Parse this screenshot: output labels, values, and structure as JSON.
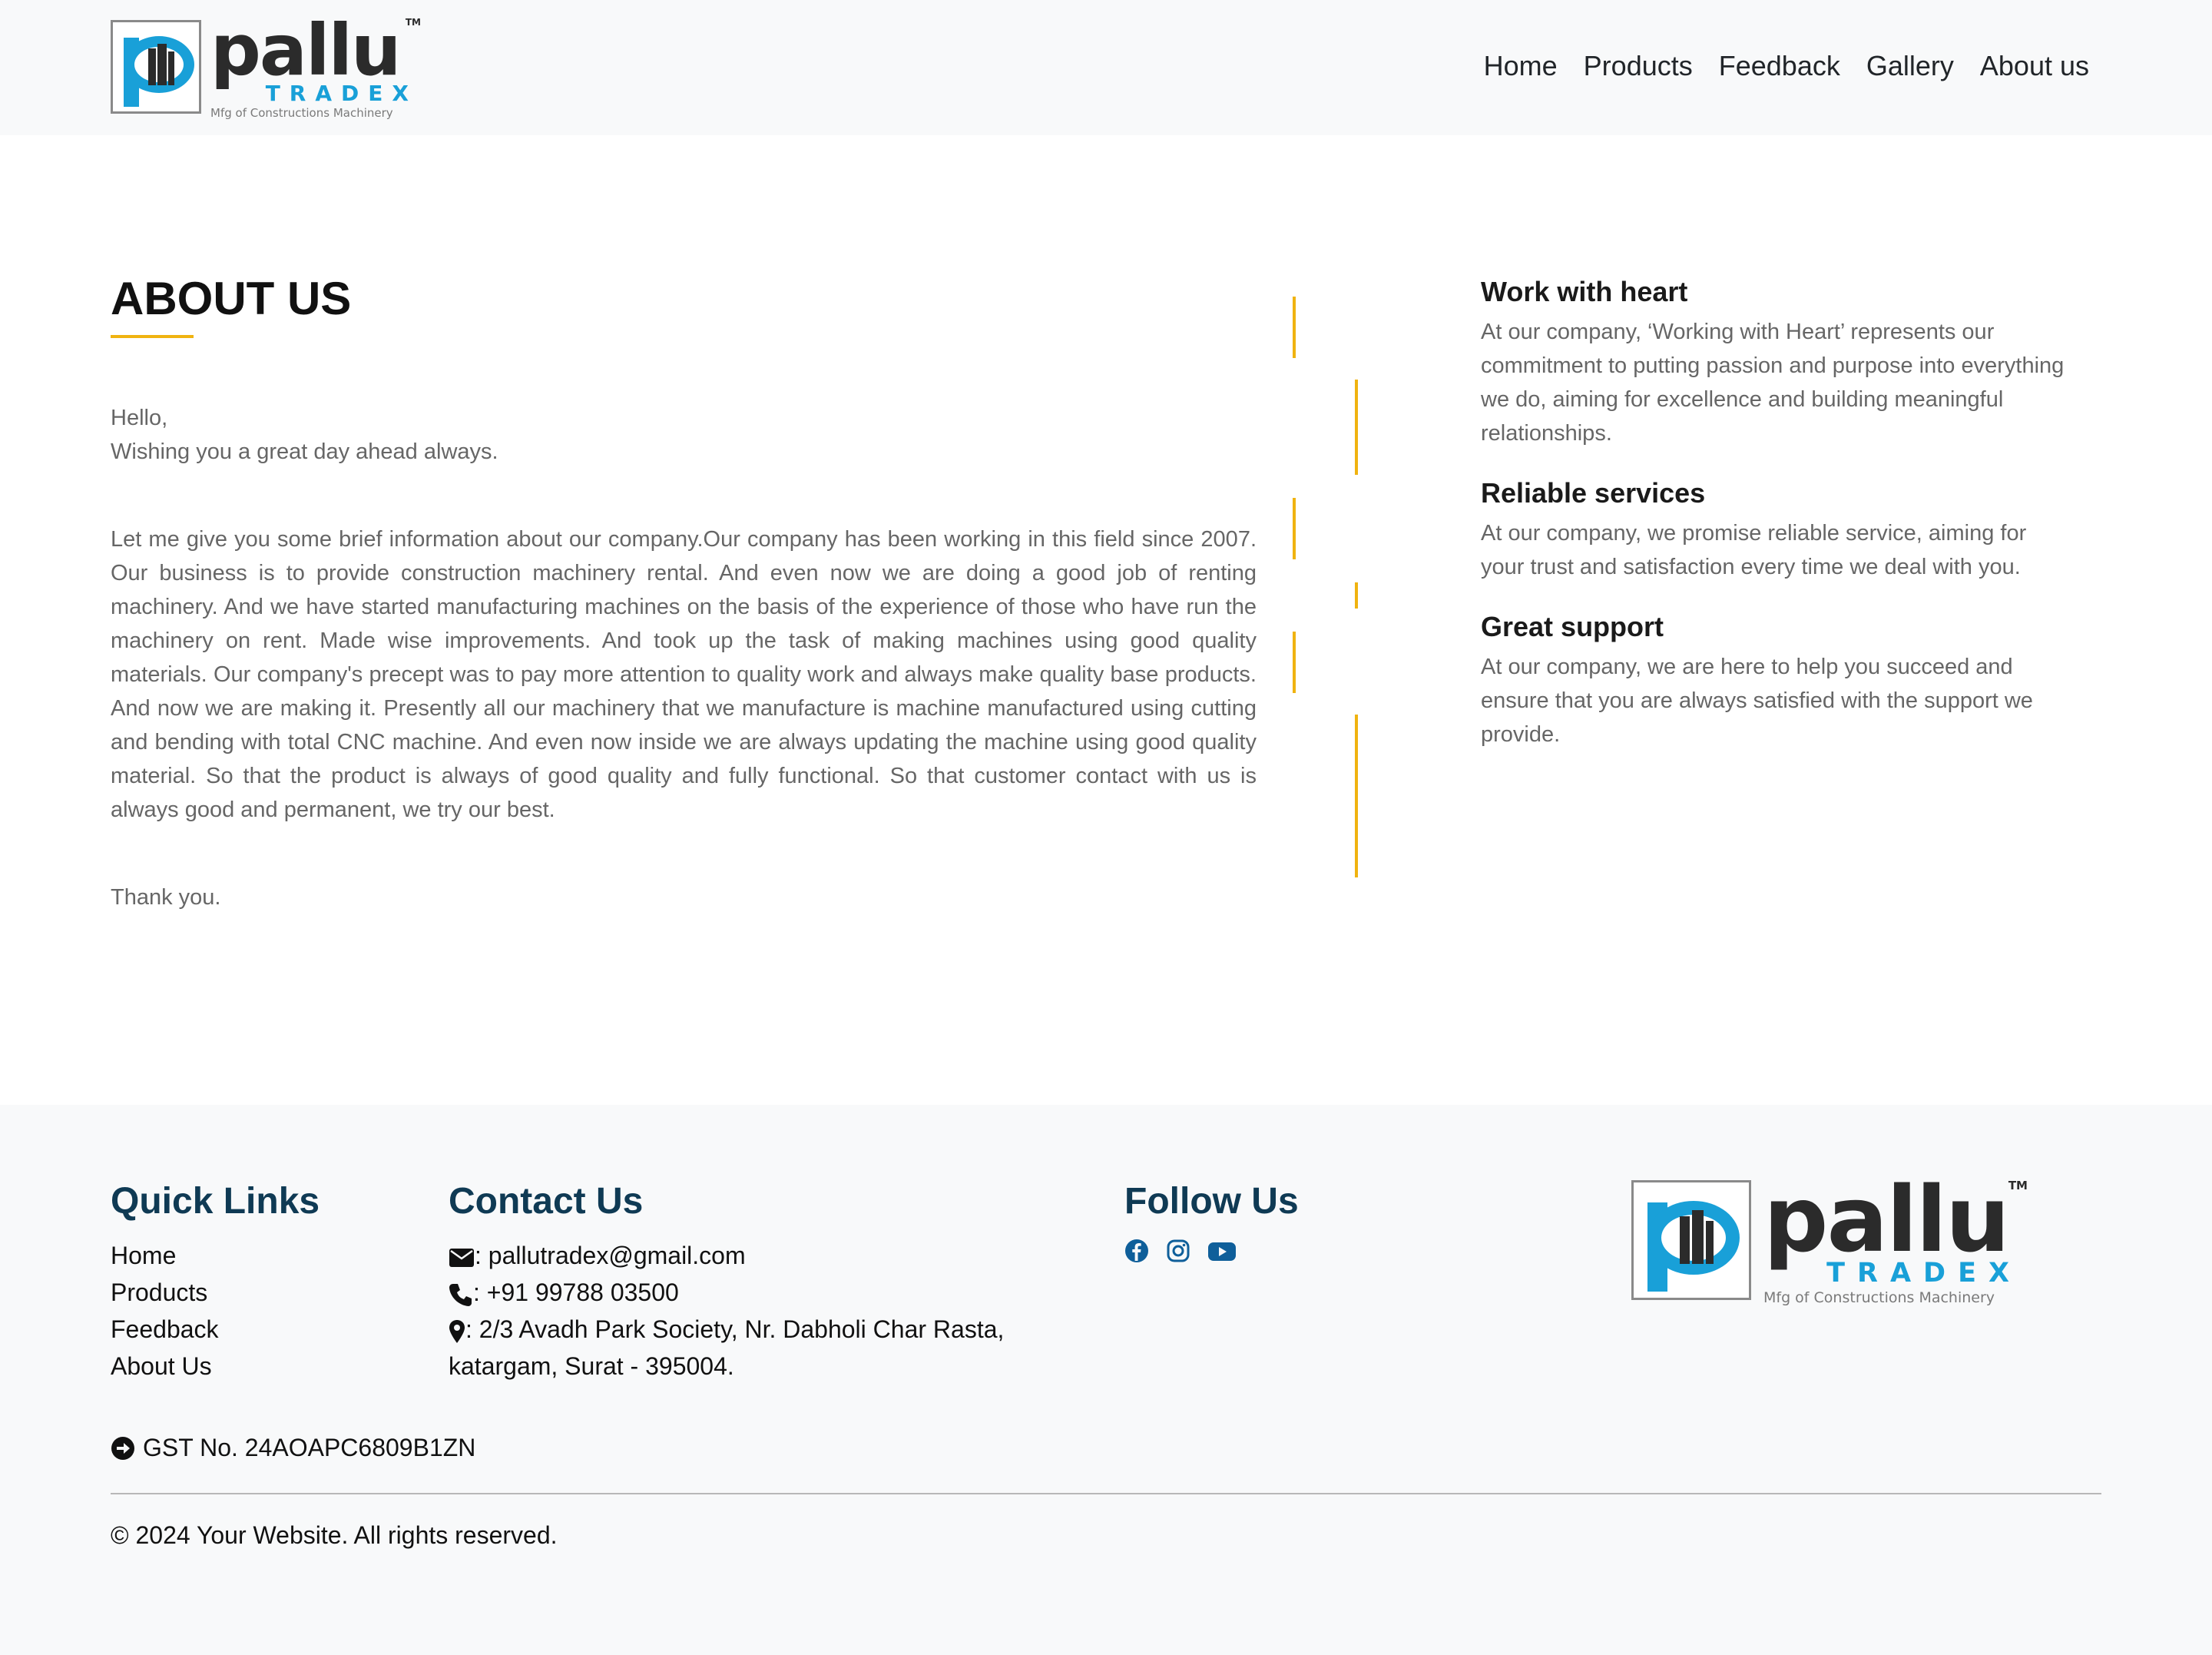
{
  "header": {
    "logo": {
      "word": "pallu",
      "sub": "TRADEX",
      "tagline": "Mfg of Constructions Machinery",
      "tm": "TM"
    },
    "nav": [
      {
        "label": "Home"
      },
      {
        "label": "Products"
      },
      {
        "label": "Feedback"
      },
      {
        "label": "Gallery"
      },
      {
        "label": "About us"
      }
    ]
  },
  "about": {
    "title": "ABOUT US",
    "greeting": "Hello,",
    "wish": "Wishing you a great day ahead always.",
    "body": "Let me give you some brief information about our company.Our company has been working in this field since 2007. Our business is to provide construction machinery rental. And even now we are doing a good job of renting machinery. And we have started manufacturing machines on the basis of the experience of those who have run the machinery on rent. Made wise improvements. And took up the task of making machines using good quality materials. Our company's precept was to pay more attention to quality work and always make quality base products. And now we are making it. Presently all our machinery that we manufacture is machine manufactured using cutting and bending with total CNC machine. And even now inside we are always updating the machine using good quality material. So that the product is always of good quality and fully functional. So that customer contact with us is always good and permanent, we try our best.",
    "closing": "Thank you."
  },
  "features": [
    {
      "title": "Work with heart",
      "text": "At our company, ‘Working with Heart’ represents our commitment to putting passion and purpose into everything we do, aiming for excellence and building meaningful relationships."
    },
    {
      "title": "Reliable services",
      "text": "At our company, we promise reliable service, aiming for your trust and satisfaction every time we deal with you."
    },
    {
      "title": "Great support",
      "text": "At our company, we are here to help you succeed and ensure that you are always satisfied with the support we provide."
    }
  ],
  "footer": {
    "quick_links": {
      "heading": "Quick Links",
      "items": [
        {
          "label": "Home"
        },
        {
          "label": "Products"
        },
        {
          "label": "Feedback"
        },
        {
          "label": "About Us"
        }
      ]
    },
    "contact": {
      "heading": "Contact Us",
      "email": ": pallutradex@gmail.com",
      "phone": ": +91 99788 03500",
      "address_line1": ": 2/3 Avadh Park Society, Nr. Dabholi Char Rasta,",
      "address_line2": "katargam, Surat - 395004."
    },
    "follow": {
      "heading": "Follow Us",
      "icons": [
        "facebook-icon",
        "instagram-icon",
        "youtube-icon"
      ],
      "color": "#0f5f9a"
    },
    "gst": "GST No. 24AOAPC6809B1ZN",
    "copyright": "© 2024 Your Website. All rights reserved."
  },
  "colors": {
    "accent": "#f0b310",
    "brand_blue": "#19a0d8",
    "footer_heading": "#0f3a54",
    "header_bg": "#f8f9fa"
  }
}
